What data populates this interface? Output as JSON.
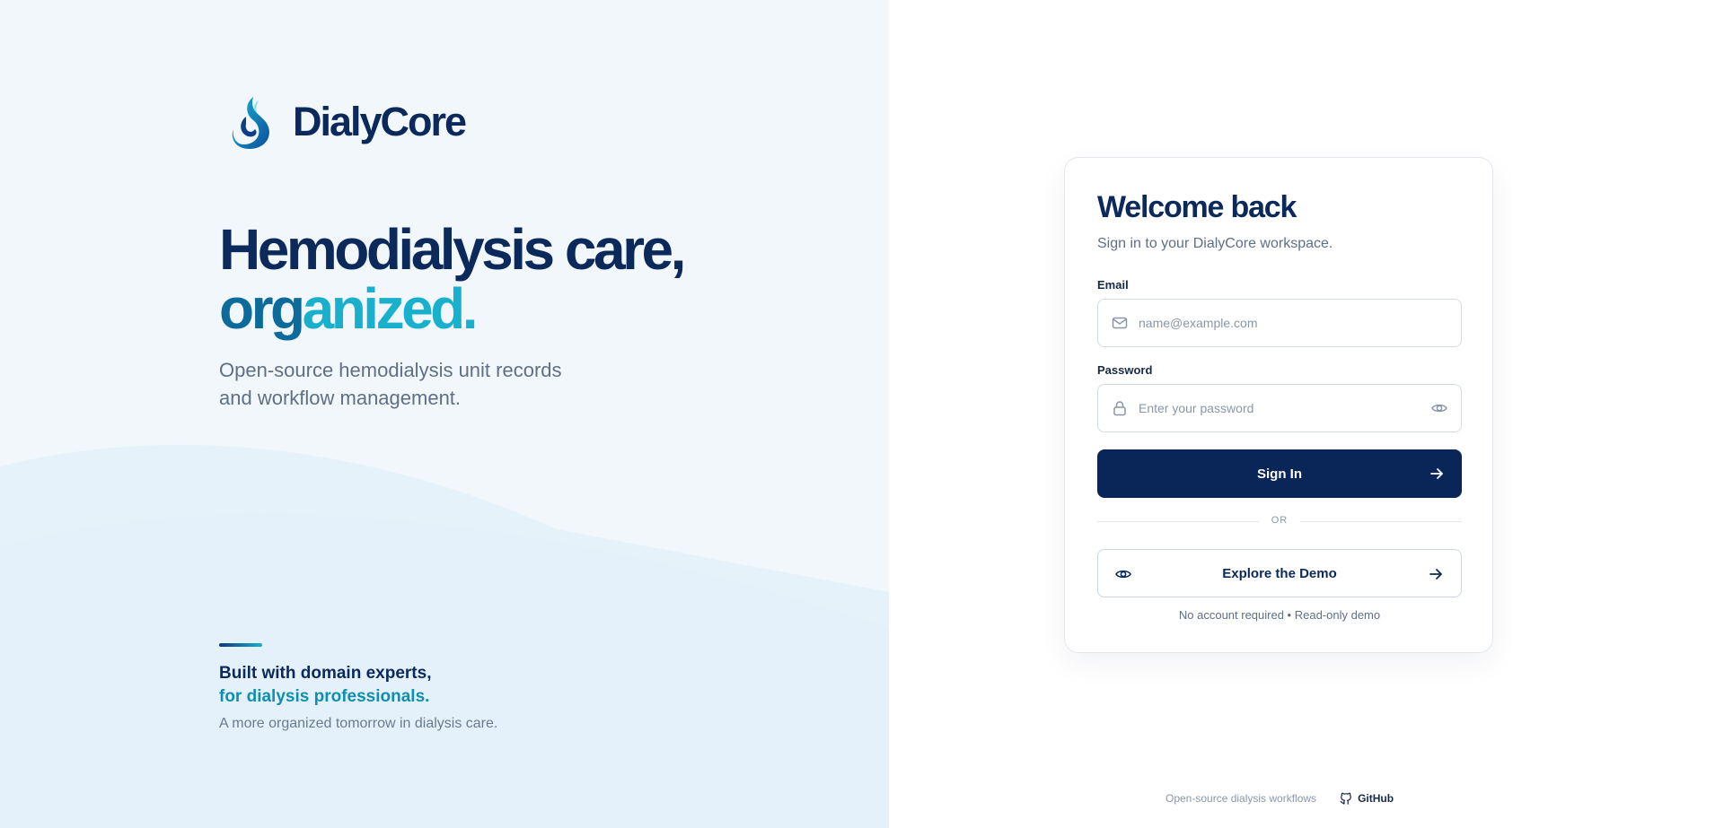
{
  "brand": {
    "name": "DialyCore",
    "logo_icon": "droplet-logo-icon"
  },
  "hero": {
    "line1": "Hemodialysis care,",
    "line2_part1": "org",
    "line2_part2": "anized",
    "line2_part3": "."
  },
  "subtitle_line1": "Open-source hemodialysis unit records",
  "subtitle_line2": "and workflow management.",
  "built": {
    "line1": "Built with domain experts,",
    "line2": "for dialysis professionals.",
    "tagline": "A more organized tomorrow in dialysis care."
  },
  "login": {
    "title": "Welcome back",
    "subtitle": "Sign in to your DialyCore workspace.",
    "email_label": "Email",
    "email_placeholder": "name@example.com",
    "email_value": "",
    "password_label": "Password",
    "password_placeholder": "Enter your password",
    "password_value": "",
    "sign_in_label": "Sign In",
    "or_label": "OR",
    "demo_label": "Explore the Demo",
    "demo_note": "No account required • Read-only demo"
  },
  "footer": {
    "text": "Open-source dialysis workflows",
    "github_label": "GitHub"
  },
  "colors": {
    "navy": "#0b2a5b",
    "primary_button": "#0a2558",
    "teal": "#18b0cd",
    "left_panel_bg": "#f1f7fb"
  }
}
